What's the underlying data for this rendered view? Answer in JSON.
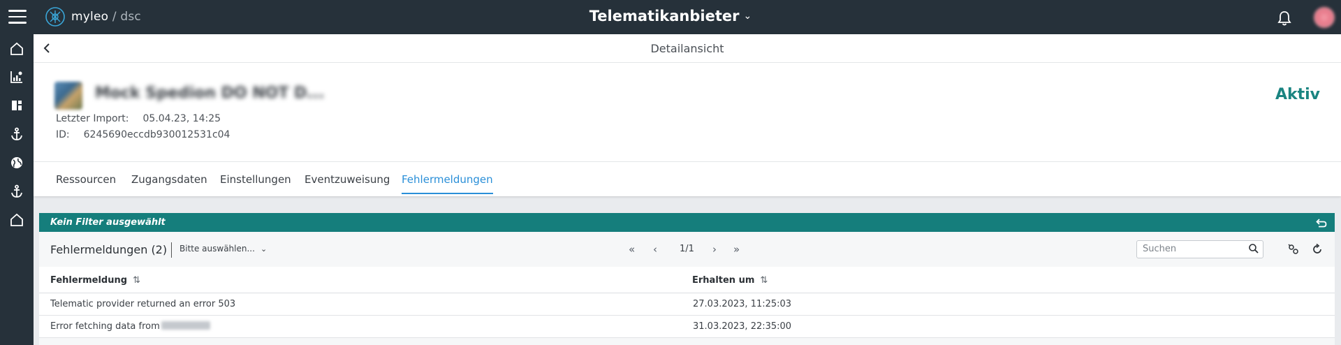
{
  "topbar": {
    "app_name": "myleo",
    "app_suffix": "dsc",
    "title": "Telematikanbieter"
  },
  "sidebar": {
    "items": [
      {
        "icon": "home-icon"
      },
      {
        "icon": "chart-icon"
      },
      {
        "icon": "dashboard-icon"
      },
      {
        "icon": "anchor-icon"
      },
      {
        "icon": "globe-icon"
      },
      {
        "icon": "anchor-icon"
      },
      {
        "icon": "home-icon"
      }
    ]
  },
  "subheader": {
    "title": "Detailansicht"
  },
  "provider": {
    "name": "Mock Spedion DO NOT D...",
    "last_import_label": "Letzter Import:",
    "last_import_value": "05.04.23, 14:25",
    "id_label": "ID:",
    "id_value": "6245690eccdb930012531c04",
    "status": "Aktiv"
  },
  "tabs": [
    {
      "label": "Ressourcen"
    },
    {
      "label": "Zugangsdaten"
    },
    {
      "label": "Einstellungen"
    },
    {
      "label": "Eventzuweisung"
    },
    {
      "label": "Fehlermeldungen",
      "active": true
    }
  ],
  "filter": {
    "text": "Kein Filter ausgewählt"
  },
  "table": {
    "title": "Fehlermeldungen (2)",
    "select_placeholder": "Bitte auswählen...",
    "page": "1/1",
    "search_placeholder": "Suchen",
    "columns": [
      "Fehlermeldung",
      "Erhalten um"
    ],
    "rows": [
      {
        "message": "Telematic provider returned an error 503",
        "received": "27.03.2023, 11:25:03"
      },
      {
        "message": "Error fetching data from",
        "received": "31.03.2023, 22:35:00"
      }
    ]
  },
  "colors": {
    "topbar": "#26313a",
    "accent_teal": "#157e7c",
    "active_tab": "#2a8fd8"
  }
}
